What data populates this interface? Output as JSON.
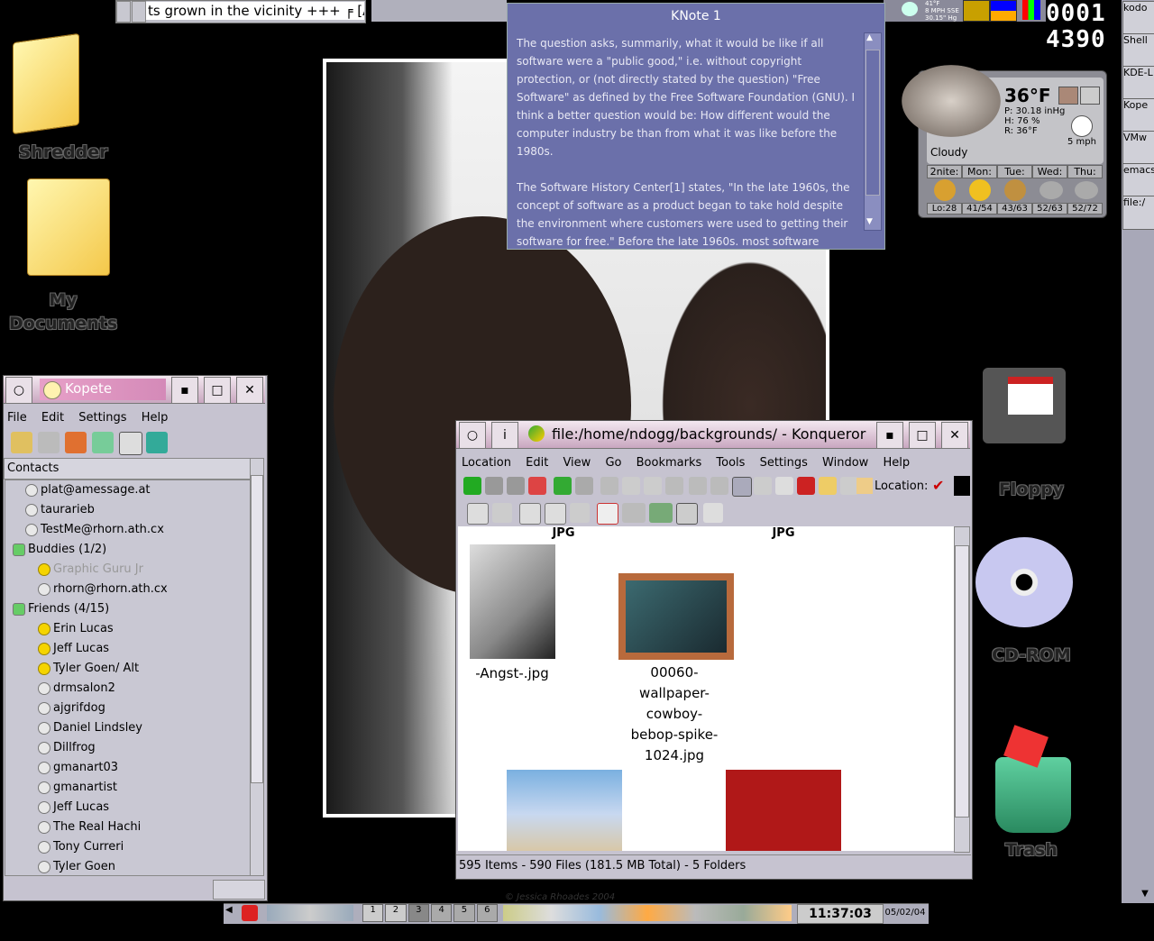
{
  "top_panel": {
    "ticker_text": "ts grown in the vicinity +++ ╒ [A",
    "weather_mini": [
      "41°F",
      "8 MPH SSE",
      "30.15\" Hg"
    ],
    "counter_top": "0001",
    "counter_bottom": "4390"
  },
  "right_column": {
    "items": [
      "kodo",
      "Shell",
      "KDE-L",
      "Kope",
      "VMw",
      "emacs",
      "file:/"
    ]
  },
  "desktop_icons": {
    "shredder": "Shredder",
    "my_documents_line1": "My",
    "my_documents_line2": "Documents",
    "floppy": "Floppy",
    "cdrom": "CD-ROM",
    "trash": "Trash"
  },
  "knote": {
    "title": "KNote 1",
    "paragraphs": [
      "The question asks, summarily, what it would be like if all software were a \"public good,\" i.e. without copyright protection, or (not directly stated by the question) \"Free Software\" as defined by the Free Software Foundation (GNU).  I think a better question would be: How different would the computer industry be than from what it was like before the 1980s.",
      "The Software History Center[1] states, \"In the late 1960s, the concept of software as a product began to take hold despite the environment where customers were used to getting their software for free.\"  Before the late 1960s, most software"
    ]
  },
  "weather": {
    "temp": "36°F",
    "pressure": "P: 30.18 inHg",
    "humidity": "H: 76 %",
    "real": "R: 36°F",
    "wind": "5 mph",
    "condition": "Cloudy",
    "days": [
      {
        "name": "2nite:",
        "range": "Lo:28"
      },
      {
        "name": "Mon:",
        "range": "41/54"
      },
      {
        "name": "Tue:",
        "range": "43/63"
      },
      {
        "name": "Wed:",
        "range": "52/63"
      },
      {
        "name": "Thu:",
        "range": "52/72"
      }
    ]
  },
  "kopete": {
    "title": "Kopete",
    "menu": [
      "File",
      "Edit",
      "Settings",
      "Help"
    ],
    "header": "Contacts",
    "contacts": [
      {
        "label": "plat@amessage.at",
        "indent": 1,
        "kind": "off"
      },
      {
        "label": "taurarieb",
        "indent": 1,
        "kind": "off"
      },
      {
        "label": "TestMe@rhorn.ath.cx",
        "indent": 1,
        "kind": "off"
      },
      {
        "label": "Buddies (1/2)",
        "indent": 0,
        "kind": "grp"
      },
      {
        "label": "Graphic Guru Jr",
        "indent": 2,
        "kind": "on",
        "dim": true
      },
      {
        "label": "rhorn@rhorn.ath.cx",
        "indent": 2,
        "kind": "off"
      },
      {
        "label": "Friends (4/15)",
        "indent": 0,
        "kind": "grp"
      },
      {
        "label": "Erin Lucas",
        "indent": 2,
        "kind": "on"
      },
      {
        "label": "Jeff Lucas",
        "indent": 2,
        "kind": "on"
      },
      {
        "label": "Tyler Goen/ Alt",
        "indent": 2,
        "kind": "on"
      },
      {
        "label": "drmsalon2",
        "indent": 2,
        "kind": "off"
      },
      {
        "label": "ajgrifdog",
        "indent": 2,
        "kind": "off"
      },
      {
        "label": "Daniel Lindsley",
        "indent": 2,
        "kind": "off"
      },
      {
        "label": "Dillfrog",
        "indent": 2,
        "kind": "off"
      },
      {
        "label": "gmanart03",
        "indent": 2,
        "kind": "off"
      },
      {
        "label": "gmanartist",
        "indent": 2,
        "kind": "off"
      },
      {
        "label": "Jeff Lucas",
        "indent": 2,
        "kind": "off"
      },
      {
        "label": "The Real Hachi",
        "indent": 2,
        "kind": "off"
      },
      {
        "label": "Tony Curreri",
        "indent": 2,
        "kind": "off"
      },
      {
        "label": "Tyler Goen",
        "indent": 2,
        "kind": "off"
      }
    ]
  },
  "konqueror": {
    "title": "file:/home/ndogg/backgrounds/ - Konqueror",
    "menu": [
      "Location",
      "Edit",
      "View",
      "Go",
      "Bookmarks",
      "Tools",
      "Settings",
      "Window",
      "Help"
    ],
    "location_label": "Location:",
    "files": [
      {
        "top_label": "JPG",
        "name": "-Angst-.jpg"
      },
      {
        "top_label": "JPG",
        "name_lines": [
          "00060-",
          "wallpaper-",
          "cowboy-",
          "bebop-spike-",
          "1024.jpg"
        ]
      }
    ],
    "status": "595 Items - 590 Files (181.5 MB Total) - 5 Folders"
  },
  "wallpaper": {
    "credit": "© Jessica Rhoades 2004"
  },
  "taskbar": {
    "clock": "11:37:03 pm",
    "date": "05/02/04",
    "desktops": [
      "1",
      "2",
      "3",
      "4",
      "5",
      "6"
    ]
  }
}
